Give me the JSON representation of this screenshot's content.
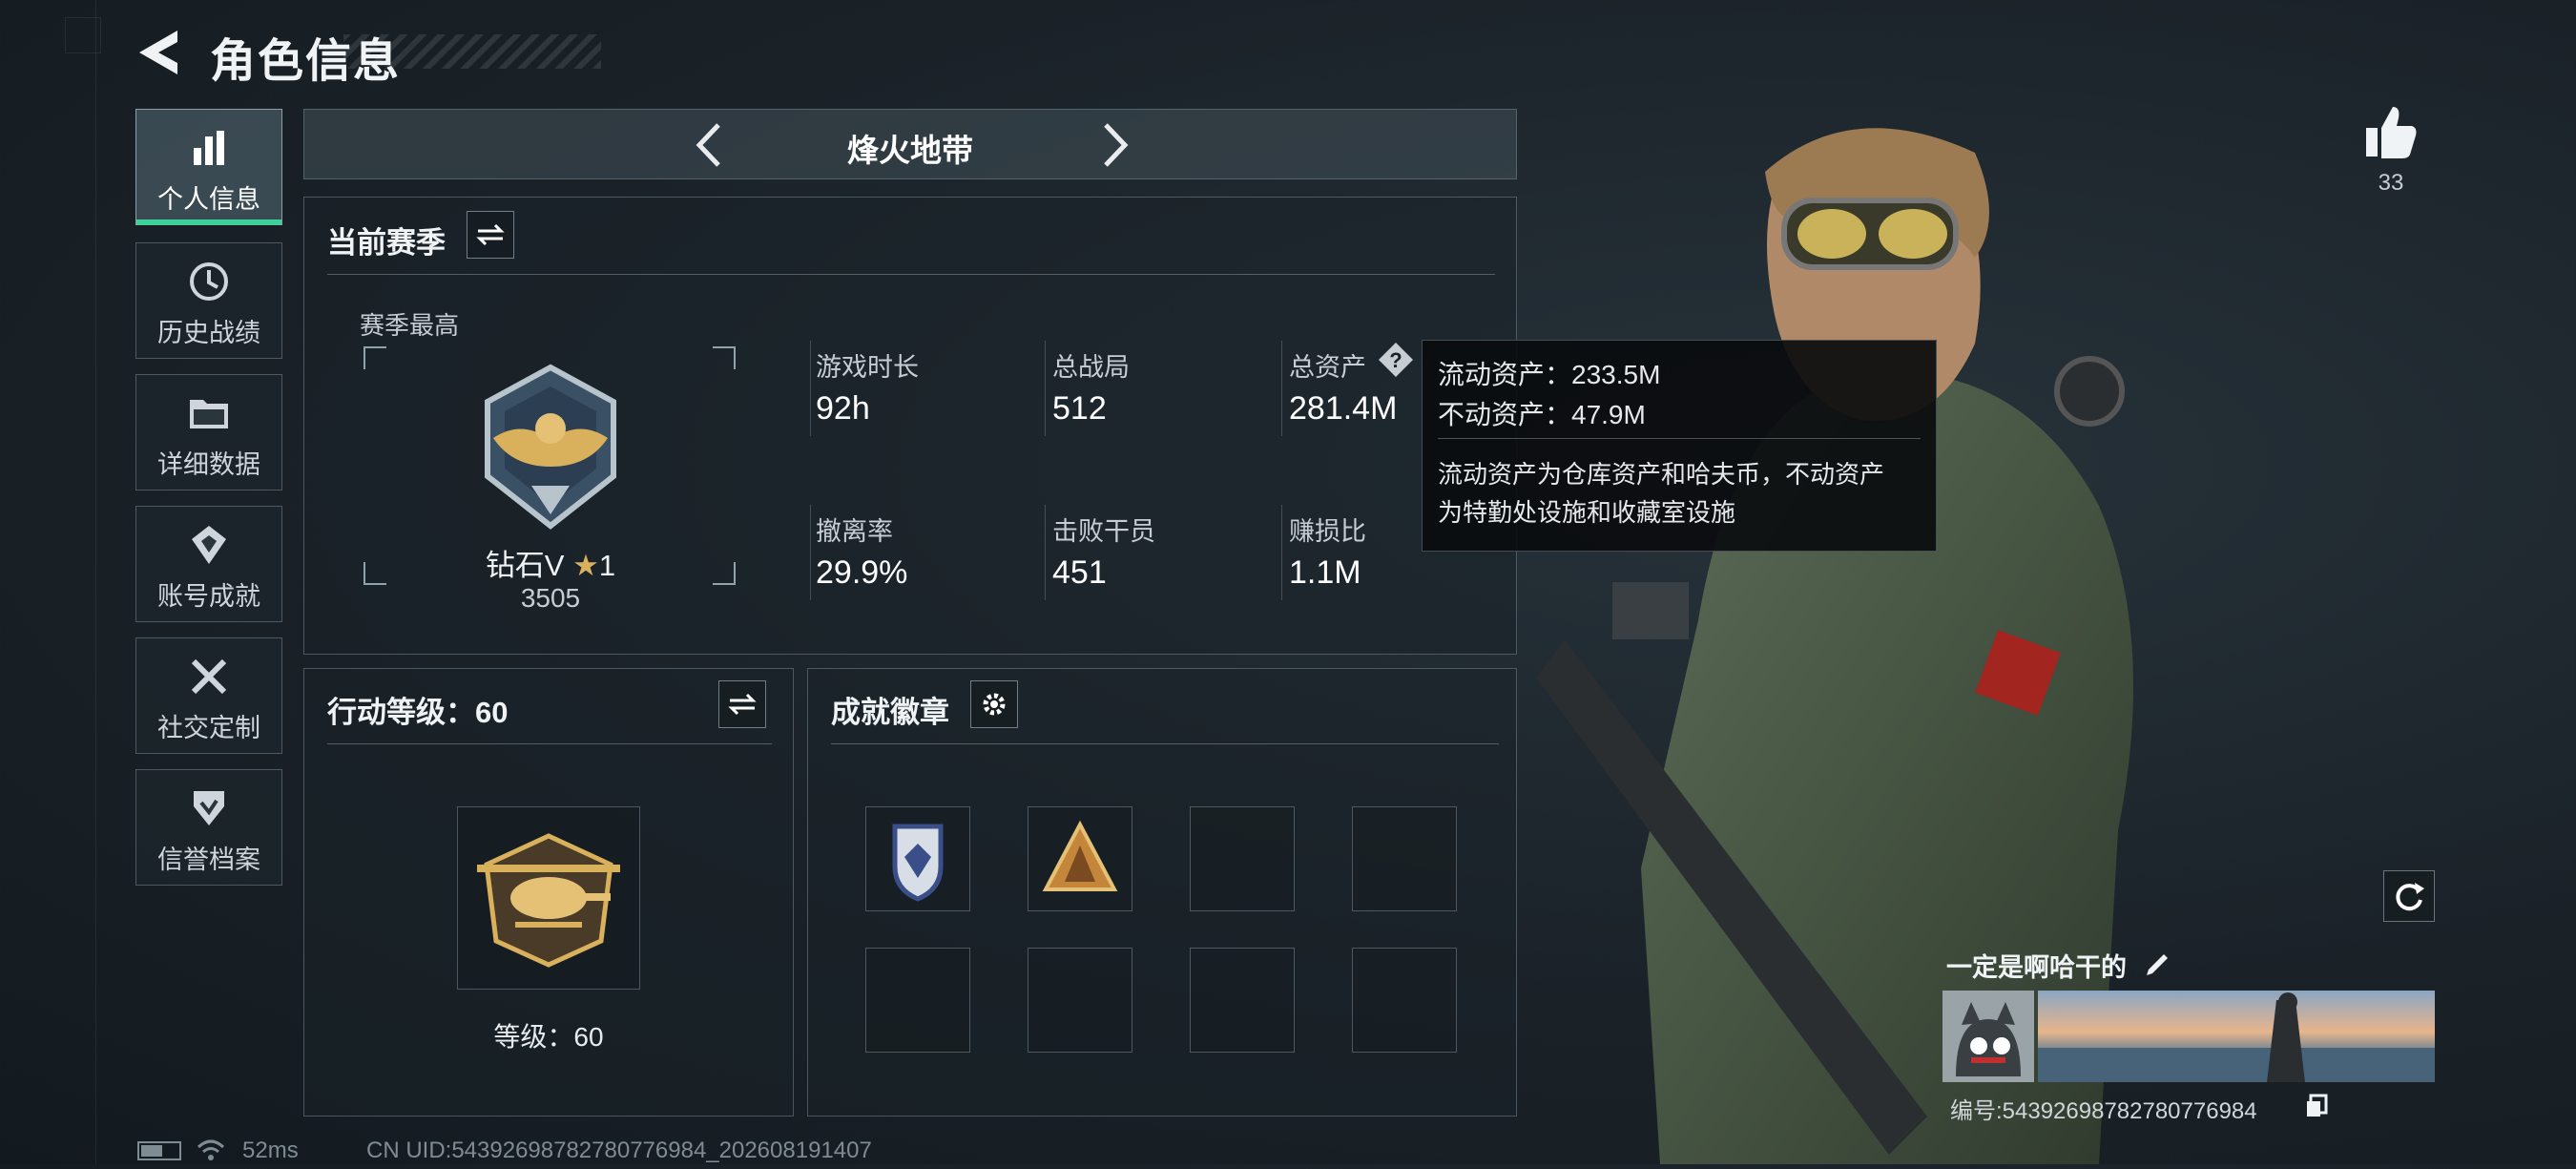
{
  "header": {
    "title": "角色信息"
  },
  "sidebar": {
    "items": [
      {
        "label": "个人信息",
        "icon": "bar-chart-icon",
        "active": true
      },
      {
        "label": "历史战绩",
        "icon": "history-icon",
        "active": false
      },
      {
        "label": "详细数据",
        "icon": "folder-icon",
        "active": false
      },
      {
        "label": "账号成就",
        "icon": "achievement-icon",
        "active": false
      },
      {
        "label": "社交定制",
        "icon": "tools-icon",
        "active": false
      },
      {
        "label": "信誉档案",
        "icon": "credit-icon",
        "active": false
      }
    ]
  },
  "mode": {
    "name": "烽火地带"
  },
  "season": {
    "title": "当前赛季",
    "best_label": "赛季最高",
    "rank_name": "钻石V",
    "rank_stars": "1",
    "rank_score": "3505",
    "stats": [
      {
        "label": "游戏时长",
        "value": "92h"
      },
      {
        "label": "总战局",
        "value": "512"
      },
      {
        "label": "总资产",
        "value": "281.4M"
      },
      {
        "label": "撤离率",
        "value": "29.9%"
      },
      {
        "label": "击败干员",
        "value": "451"
      },
      {
        "label": "赚损比",
        "value": "1.1M"
      }
    ]
  },
  "tooltip": {
    "line1": "流动资产：233.5M",
    "line2": "不动资产：47.9M",
    "line3": "流动资产为仓库资产和哈夫币，不动资产",
    "line4": "为特勤处设施和收藏室设施"
  },
  "action_level": {
    "title": "行动等级：60",
    "level_label": "等级：60"
  },
  "badges": {
    "title": "成就徽章"
  },
  "likes": {
    "count": "33"
  },
  "profile": {
    "name": "一定是啊哈干的",
    "id_label": "编号:5439269878278077698​4"
  },
  "status_bar": {
    "ping": "52ms",
    "uid": "CN UID:54392698782780776984_202608191407"
  },
  "colors": {
    "accent": "#3fd19a",
    "panel_border": "#8fa3ad",
    "gold": "#d9b05c"
  }
}
